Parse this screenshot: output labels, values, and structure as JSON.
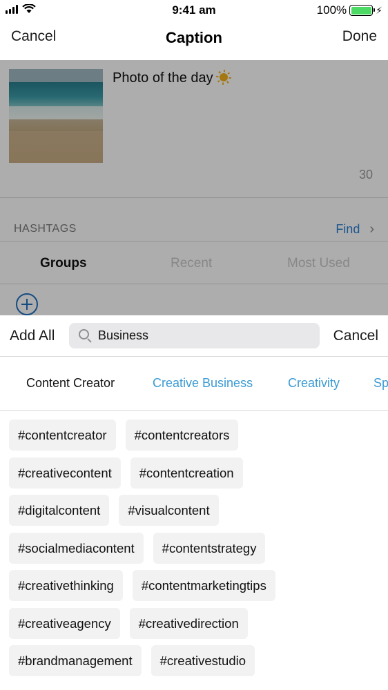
{
  "status_bar": {
    "time": "9:41 am",
    "battery_percent": "100%",
    "battery_level": 1.0,
    "battery_color": "#4cd964"
  },
  "nav": {
    "cancel_label": "Cancel",
    "title": "Caption",
    "done_label": "Done"
  },
  "caption": {
    "text": "Photo of the day",
    "emoji_icon": "sun-icon",
    "char_count": "30"
  },
  "hashtags": {
    "section_label": "HASHTAGS",
    "find_label": "Find",
    "segments": [
      "Groups",
      "Recent",
      "Most Used"
    ],
    "active_segment": "Groups"
  },
  "search_sheet": {
    "add_all_label": "Add All",
    "search_value": "Business",
    "cancel_label": "Cancel",
    "categories": [
      "Content Creator",
      "Creative Business",
      "Creativity",
      "Sp"
    ],
    "active_category": "Content Creator",
    "tag_rows": [
      [
        "#contentcreator",
        "#contentcreators"
      ],
      [
        "#creativecontent",
        "#contentcreation"
      ],
      [
        "#digitalcontent",
        "#visualcontent"
      ],
      [
        "#socialmediacontent",
        "#contentstrategy"
      ],
      [
        "#creativethinking",
        "#contentmarketingtips"
      ],
      [
        "#creativeagency",
        "#creativedirection"
      ],
      [
        "#brandmanagement",
        "#creativestudio"
      ]
    ]
  },
  "colors": {
    "accent_blue": "#2a7fd4",
    "category_blue": "#3a9ad4",
    "tag_bg": "#f2f2f2",
    "overlay": "rgba(0,0,0,0.32)"
  }
}
